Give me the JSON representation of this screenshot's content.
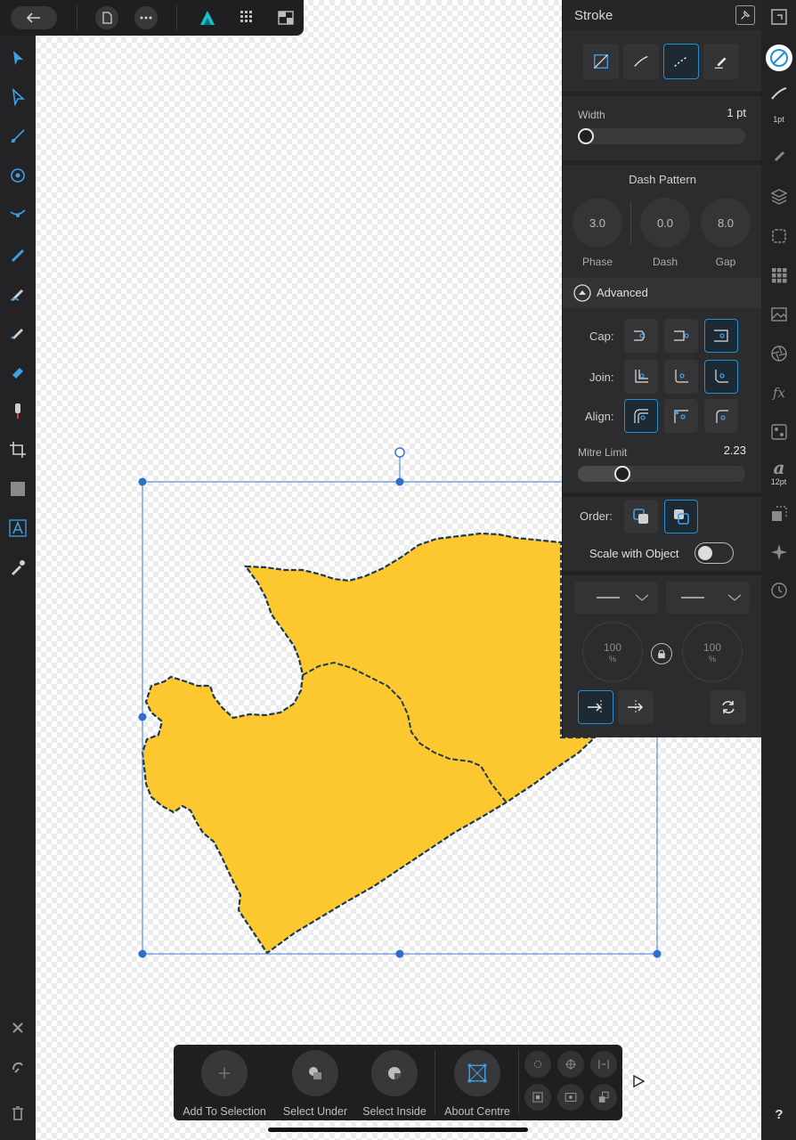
{
  "top_bar": {
    "back_icon": "back-arrow-icon",
    "document_icon": "document-icon",
    "more_icon": "more-icon",
    "persona_icon": "designer-persona-icon",
    "pixel_persona_icon": "pixel-persona-icon",
    "export_persona_icon": "export-persona-icon"
  },
  "stroke_panel": {
    "title": "Stroke",
    "width_label": "Width",
    "width_value": "1 pt",
    "width_fraction": 0.0,
    "dash_pattern_title": "Dash Pattern",
    "dash_dials": [
      {
        "value": "3.0",
        "label": "Phase"
      },
      {
        "value": "0.0",
        "label": "Dash"
      },
      {
        "value": "8.0",
        "label": "Gap"
      }
    ],
    "advanced_label": "Advanced",
    "cap_label": "Cap:",
    "join_label": "Join:",
    "align_label": "Align:",
    "mitre_limit_label": "Mitre Limit",
    "mitre_limit_value": "2.23",
    "mitre_limit_fraction": 0.24,
    "order_label": "Order:",
    "scale_with_object_label": "Scale with Object",
    "scale_with_object_on": false,
    "arrow_start_pct": "100",
    "arrow_end_pct": "100",
    "pct_unit": "%"
  },
  "right_bar": {
    "stroke_width_label": "1pt",
    "font_size_label": "12pt"
  },
  "context_bar": {
    "add_to_selection": "Add To Selection",
    "select_under": "Select Under",
    "select_inside": "Select Inside",
    "about_centre": "About Centre"
  },
  "colors": {
    "fill": "#fdc82f",
    "stroke": "#1a3a55",
    "accent": "#1f8fd6",
    "selection": "#3a7bd5"
  }
}
